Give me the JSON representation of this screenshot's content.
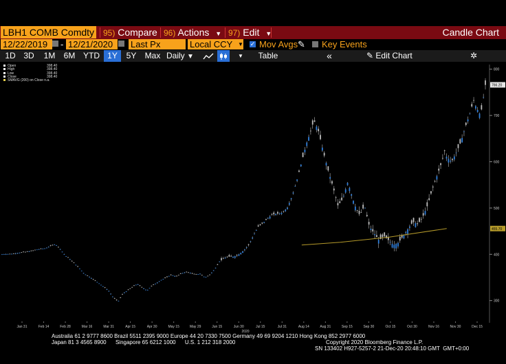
{
  "header": {
    "ticker": "LBH1 COMB Comdty",
    "menus": [
      {
        "num": "95)",
        "label": "Compare"
      },
      {
        "num": "96)",
        "label": "Actions"
      },
      {
        "num": "97)",
        "label": "Edit"
      }
    ],
    "title": "Candle Chart"
  },
  "controls": {
    "start_date": "12/22/2019",
    "end_date": "12/21/2020",
    "price_field": "Last Px",
    "currency": "Local CCY",
    "mov_avgs": "Mov Avgs",
    "key_events": "Key Events",
    "mov_avgs_checked": true,
    "key_events_checked": false
  },
  "toolbar": {
    "ranges": [
      "1D",
      "3D",
      "1M",
      "6M",
      "YTD",
      "1Y",
      "5Y",
      "Max"
    ],
    "active_range": "1Y",
    "period": "Daily",
    "table_label": "Table",
    "edit_chart_label": "Edit Chart",
    "collapse_icon": "double-chevron-left-icon",
    "pencil_icon": "pencil-icon"
  },
  "legend": [
    {
      "label": "Open",
      "value": "398.40",
      "color": "#ffffff"
    },
    {
      "label": "High",
      "value": "398.40",
      "color": "#ffffff"
    },
    {
      "label": "Low",
      "value": "398.40",
      "color": "#ffffff"
    },
    {
      "label": "Close",
      "value": "398.40",
      "color": "#ffffff"
    },
    {
      "label": "SMAVG (200)  on Close",
      "value": "n.a.",
      "color": "#e8d44d"
    }
  ],
  "colors": {
    "up": "#2f7fdc",
    "down": "#bdbdbd",
    "sma": "#b59a2a",
    "accent": "#f7a21b",
    "bar": "#7a0a12"
  },
  "chart_data": {
    "type": "candlestick",
    "y_axis": {
      "min": 255,
      "max": 810,
      "ticks": [
        300,
        400,
        500,
        600,
        700,
        800
      ]
    },
    "x_ticks": [
      "Jan 31",
      "Feb 14",
      "Feb 28",
      "Mar 16",
      "Mar 31",
      "Apr 15",
      "Apr 30",
      "May 15",
      "May 29",
      "Jun 15",
      "Jun 30",
      "Jul 15",
      "Jul 31",
      "Aug 14",
      "Aug 31",
      "Sep 15",
      "Sep 30",
      "Oct 15",
      "Oct 30",
      "Nov 16",
      "Nov 30",
      "Dec 15"
    ],
    "year_label": "2020",
    "last_price": 766.2,
    "last_price_label": "766.20",
    "sma_label": "455.70",
    "sma200": [
      [
        0.62,
        420
      ],
      [
        0.7,
        426
      ],
      [
        0.8,
        437
      ],
      [
        0.92,
        455.7
      ]
    ],
    "series_points": [
      [
        0.0,
        400
      ],
      [
        0.02,
        401
      ],
      [
        0.04,
        404
      ],
      [
        0.06,
        407
      ],
      [
        0.07,
        410
      ],
      [
        0.09,
        413
      ],
      [
        0.1,
        418
      ],
      [
        0.11,
        422
      ],
      [
        0.12,
        412
      ],
      [
        0.13,
        398
      ],
      [
        0.14,
        390
      ],
      [
        0.15,
        380
      ],
      [
        0.16,
        370
      ],
      [
        0.17,
        358
      ],
      [
        0.18,
        352
      ],
      [
        0.19,
        345
      ],
      [
        0.2,
        338
      ],
      [
        0.21,
        330
      ],
      [
        0.22,
        322
      ],
      [
        0.23,
        307
      ],
      [
        0.24,
        298
      ],
      [
        0.25,
        315
      ],
      [
        0.26,
        322
      ],
      [
        0.27,
        330
      ],
      [
        0.28,
        336
      ],
      [
        0.29,
        328
      ],
      [
        0.3,
        322
      ],
      [
        0.31,
        332
      ],
      [
        0.32,
        338
      ],
      [
        0.33,
        345
      ],
      [
        0.34,
        350
      ],
      [
        0.35,
        356
      ],
      [
        0.36,
        352
      ],
      [
        0.37,
        358
      ],
      [
        0.38,
        362
      ],
      [
        0.39,
        360
      ],
      [
        0.4,
        356
      ],
      [
        0.41,
        358
      ],
      [
        0.42,
        350
      ],
      [
        0.43,
        356
      ],
      [
        0.44,
        368
      ],
      [
        0.45,
        385
      ],
      [
        0.46,
        392
      ],
      [
        0.47,
        395
      ],
      [
        0.48,
        395
      ],
      [
        0.49,
        400
      ],
      [
        0.5,
        408
      ],
      [
        0.51,
        420
      ],
      [
        0.52,
        440
      ],
      [
        0.53,
        460
      ],
      [
        0.54,
        468
      ],
      [
        0.55,
        478
      ],
      [
        0.56,
        486
      ],
      [
        0.57,
        488
      ],
      [
        0.58,
        490
      ],
      [
        0.59,
        500
      ],
      [
        0.6,
        525
      ],
      [
        0.61,
        560
      ],
      [
        0.62,
        600
      ],
      [
        0.63,
        640
      ],
      [
        0.64,
        670
      ],
      [
        0.645,
        690
      ],
      [
        0.655,
        665
      ],
      [
        0.665,
        620
      ],
      [
        0.675,
        580
      ],
      [
        0.685,
        545
      ],
      [
        0.695,
        505
      ],
      [
        0.705,
        520
      ],
      [
        0.715,
        555
      ],
      [
        0.72,
        540
      ],
      [
        0.73,
        505
      ],
      [
        0.74,
        485
      ],
      [
        0.75,
        505
      ],
      [
        0.76,
        460
      ],
      [
        0.77,
        445
      ],
      [
        0.78,
        430
      ],
      [
        0.79,
        440
      ],
      [
        0.8,
        430
      ],
      [
        0.81,
        420
      ],
      [
        0.82,
        425
      ],
      [
        0.83,
        440
      ],
      [
        0.84,
        455
      ],
      [
        0.85,
        470
      ],
      [
        0.86,
        465
      ],
      [
        0.87,
        480
      ],
      [
        0.88,
        505
      ],
      [
        0.89,
        540
      ],
      [
        0.9,
        570
      ],
      [
        0.91,
        600
      ],
      [
        0.915,
        625
      ],
      [
        0.92,
        610
      ],
      [
        0.93,
        600
      ],
      [
        0.94,
        620
      ],
      [
        0.95,
        645
      ],
      [
        0.96,
        680
      ],
      [
        0.97,
        710
      ],
      [
        0.975,
        735
      ],
      [
        0.98,
        720
      ],
      [
        0.99,
        700
      ],
      [
        1.0,
        766
      ]
    ]
  },
  "footer": {
    "line1": "Australia 61 2 9777 8600 Brazil 5511 2395 9000 Europe 44 20 7330 7500 Germany 49 69 9204 1210 Hong Kong 852 2977 6000",
    "line2a": "Japan 81 3 4565 8900      Singapore 65 6212 1000      U.S. 1 212 318 2000",
    "line2b": "Copyright 2020 Bloomberg Finance L.P.",
    "line3": "SN 133402 H927-5257-2 21-Dec-20 20:48:10 GMT  GMT+0:00"
  }
}
